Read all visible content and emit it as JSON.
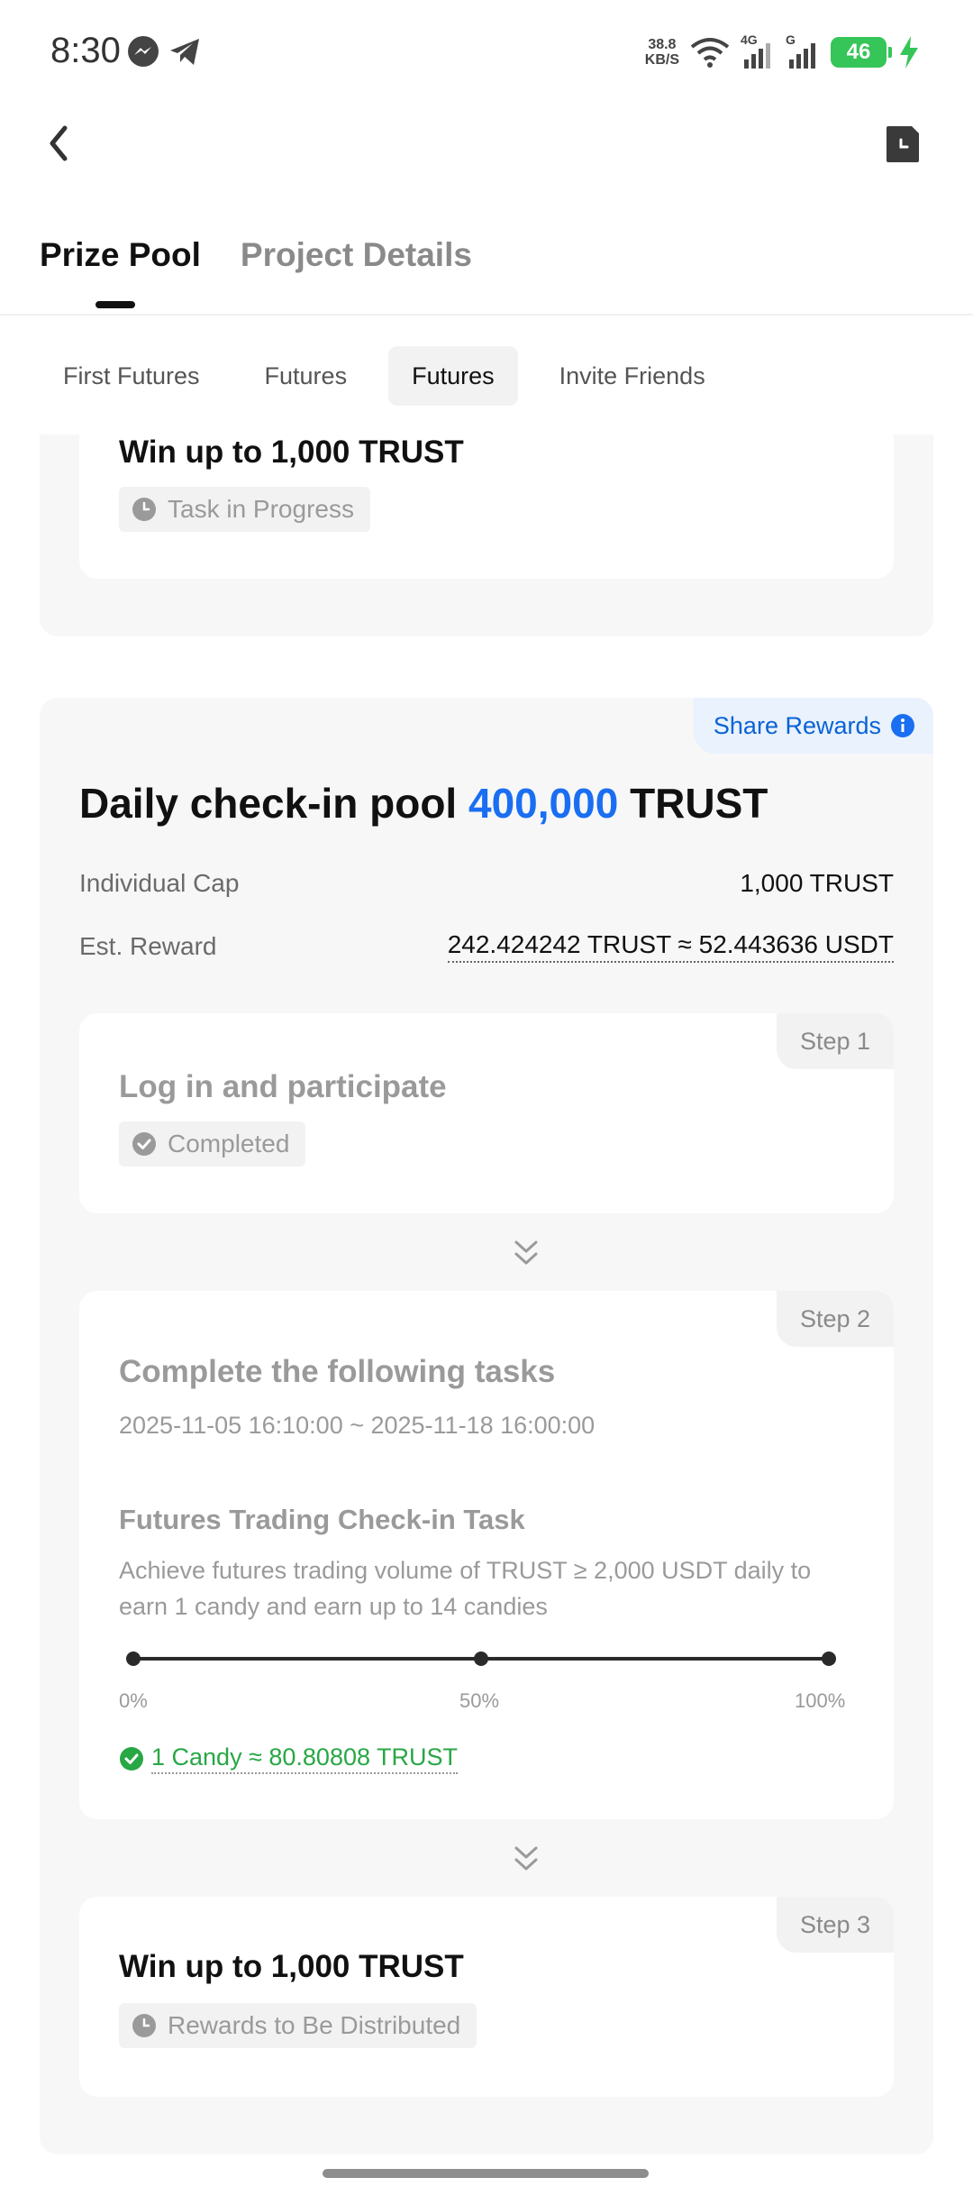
{
  "status_bar": {
    "time": "8:30",
    "speed_value": "38.8",
    "speed_unit": "KB/S",
    "net1": "4G",
    "net2": "G",
    "battery": "46",
    "icons": [
      "messenger-icon",
      "telegram-icon",
      "wifi-icon",
      "signal-icon",
      "charging-icon"
    ]
  },
  "header": {
    "back_icon": "chevron-left-icon",
    "history_icon": "history-document-icon"
  },
  "tabs": [
    {
      "label": "Prize Pool",
      "active": true
    },
    {
      "label": "Project Details",
      "active": false
    }
  ],
  "subtabs": [
    {
      "label": "First Futures",
      "active": false
    },
    {
      "label": "Futures",
      "active": false
    },
    {
      "label": "Futures",
      "active": true
    },
    {
      "label": "Invite Friends",
      "active": false
    }
  ],
  "prev_task": {
    "title": "Win up to 1,000 TRUST",
    "status": "Task in Progress"
  },
  "pool": {
    "share_label": "Share Rewards",
    "title_prefix": "Daily check-in pool",
    "title_amount": "400,000",
    "title_suffix": "TRUST",
    "cap_label": "Individual Cap",
    "cap_value": "1,000 TRUST",
    "reward_label": "Est. Reward",
    "reward_value": "242.424242 TRUST ≈ 52.443636 USDT"
  },
  "steps": [
    {
      "tag": "Step 1",
      "title": "Log in and participate",
      "status": "Completed"
    },
    {
      "tag": "Step 2",
      "title": "Complete the following tasks",
      "date_range": "2025-11-05 16:10:00 ~ 2025-11-18 16:00:00",
      "subtask_title": "Futures Trading Check-in Task",
      "subtask_desc": "Achieve futures trading volume of TRUST ≥ 2,000 USDT daily to earn 1 candy and earn up to 14 candies",
      "progress_labels": [
        "0%",
        "50%",
        "100%"
      ],
      "candy_rate": "1 Candy ≈ 80.80808 TRUST"
    },
    {
      "tag": "Step 3",
      "title": "Win up to 1,000 TRUST",
      "status": "Rewards to Be Distributed"
    }
  ],
  "colors": {
    "accent_blue": "#1a6ef2",
    "success_green": "#28a745",
    "battery_green": "#36c558"
  }
}
